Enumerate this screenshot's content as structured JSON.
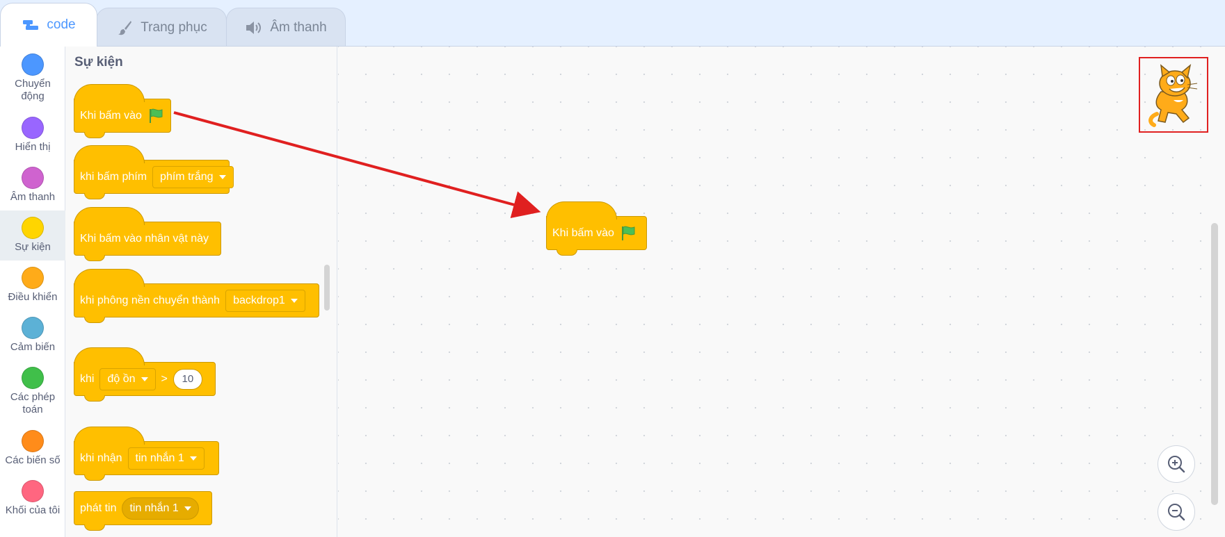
{
  "tabs": [
    {
      "label": "code",
      "icon": "code-blocks-icon",
      "active": true
    },
    {
      "label": "Trang phục",
      "icon": "paintbrush-icon",
      "active": false
    },
    {
      "label": "Âm thanh",
      "icon": "speaker-icon",
      "active": false
    }
  ],
  "categories": [
    {
      "label": "Chuyển động",
      "color": "#4c97ff"
    },
    {
      "label": "Hiển thị",
      "color": "#9966ff"
    },
    {
      "label": "Âm thanh",
      "color": "#cf63cf"
    },
    {
      "label": "Sự kiện",
      "color": "#ffd500",
      "selected": true
    },
    {
      "label": "Điều khiển",
      "color": "#ffab19"
    },
    {
      "label": "Cảm biến",
      "color": "#5cb1d6"
    },
    {
      "label": "Các phép toán",
      "color": "#40bf4a"
    },
    {
      "label": "Các biến số",
      "color": "#ff8c1a"
    },
    {
      "label": "Khối của tôi",
      "color": "#ff6680"
    }
  ],
  "flyout": {
    "title": "Sự kiện",
    "blocks": {
      "when_flag": {
        "text": "Khi bấm vào"
      },
      "when_key": {
        "text": "khi bấm phím",
        "dropdown": "phím trắng"
      },
      "when_sprite": {
        "text": "Khi bấm vào nhân vật này"
      },
      "when_backdrop": {
        "text": "khi phông nền chuyển thành",
        "dropdown": "backdrop1"
      },
      "when_greater": {
        "text": "khi",
        "dropdown": "độ ồn",
        "operator": ">",
        "value": "10"
      },
      "when_receive": {
        "text": "khi nhận",
        "dropdown": "tin nhắn 1"
      },
      "broadcast": {
        "text": "phát tin",
        "dropdown": "tin nhắn 1"
      }
    }
  },
  "workspace": {
    "block": {
      "text": "Khi bấm vào"
    },
    "sprite_thumbnail": "scratch-cat-sprite",
    "zoom_in_icon": "zoom-in-icon",
    "zoom_out_icon": "zoom-out-icon"
  },
  "annotation": {
    "arrow_color": "#e02020",
    "highlight_color": "#e02020"
  },
  "colors": {
    "events": "#ffbf00",
    "accent": "#4c97ff"
  }
}
